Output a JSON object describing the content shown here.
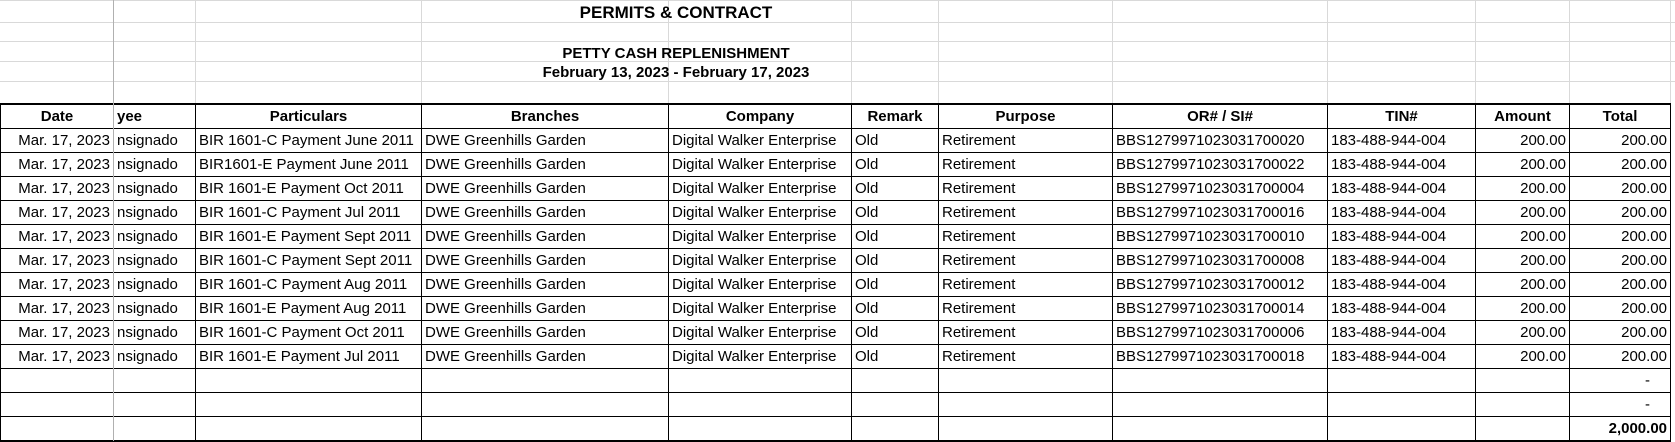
{
  "titles": {
    "main": "PERMITS & CONTRACT",
    "sub": "PETTY CASH REPLENISHMENT",
    "period": "February  13, 2023 - February 17, 2023"
  },
  "table": {
    "headers": [
      "Date",
      "yee",
      "Particulars",
      "Branches",
      "Company",
      "Remark",
      "Purpose",
      "OR# / SI#",
      "TIN#",
      "Amount",
      "Total"
    ],
    "rows": [
      [
        "Mar. 17, 2023",
        "nsignado",
        "BIR 1601-C Payment June 2011",
        "DWE Greenhills Garden",
        "Digital Walker Enterprise",
        "Old",
        "Retirement",
        "BBS1279971023031700020",
        "183-488-944-004",
        "200.00",
        "200.00"
      ],
      [
        "Mar. 17, 2023",
        "nsignado",
        "BIR1601-E Payment June 2011",
        "DWE Greenhills Garden",
        "Digital Walker Enterprise",
        "Old",
        "Retirement",
        "BBS1279971023031700022",
        "183-488-944-004",
        "200.00",
        "200.00"
      ],
      [
        "Mar. 17, 2023",
        "nsignado",
        "BIR 1601-E Payment Oct 2011",
        "DWE Greenhills Garden",
        "Digital Walker Enterprise",
        "Old",
        "Retirement",
        "BBS1279971023031700004",
        "183-488-944-004",
        "200.00",
        "200.00"
      ],
      [
        "Mar. 17, 2023",
        "nsignado",
        "BIR 1601-C Payment Jul 2011",
        "DWE Greenhills Garden",
        "Digital Walker Enterprise",
        "Old",
        "Retirement",
        "BBS1279971023031700016",
        "183-488-944-004",
        "200.00",
        "200.00"
      ],
      [
        "Mar. 17, 2023",
        "nsignado",
        "BIR 1601-E Payment Sept 2011",
        "DWE Greenhills Garden",
        "Digital Walker Enterprise",
        "Old",
        "Retirement",
        "BBS1279971023031700010",
        "183-488-944-004",
        "200.00",
        "200.00"
      ],
      [
        "Mar. 17, 2023",
        "nsignado",
        "BIR 1601-C Payment Sept 2011",
        "DWE Greenhills Garden",
        "Digital Walker Enterprise",
        "Old",
        "Retirement",
        "BBS1279971023031700008",
        "183-488-944-004",
        "200.00",
        "200.00"
      ],
      [
        "Mar. 17, 2023",
        "nsignado",
        "BIR 1601-C Payment Aug 2011",
        "DWE Greenhills Garden",
        "Digital Walker Enterprise",
        "Old",
        "Retirement",
        "BBS1279971023031700012",
        "183-488-944-004",
        "200.00",
        "200.00"
      ],
      [
        "Mar. 17, 2023",
        "nsignado",
        "BIR 1601-E Payment Aug 2011",
        "DWE Greenhills Garden",
        "Digital Walker Enterprise",
        "Old",
        "Retirement",
        "BBS1279971023031700014",
        "183-488-944-004",
        "200.00",
        "200.00"
      ],
      [
        "Mar. 17, 2023",
        "nsignado",
        "BIR 1601-C Payment Oct 2011",
        "DWE Greenhills Garden",
        "Digital Walker Enterprise",
        "Old",
        "Retirement",
        "BBS1279971023031700006",
        "183-488-944-004",
        "200.00",
        "200.00"
      ],
      [
        "Mar. 17, 2023",
        "nsignado",
        "BIR 1601-E Payment Jul 2011",
        "DWE Greenhills Garden",
        "Digital Walker Enterprise",
        "Old",
        "Retirement",
        "BBS1279971023031700018",
        "183-488-944-004",
        "200.00",
        "200.00"
      ],
      [
        "",
        "",
        "",
        "",
        "",
        "",
        "",
        "",
        "",
        "",
        "-"
      ],
      [
        "",
        "",
        "",
        "",
        "",
        "",
        "",
        "",
        "",
        "",
        "-"
      ]
    ],
    "grand_total": "2,000.00"
  }
}
